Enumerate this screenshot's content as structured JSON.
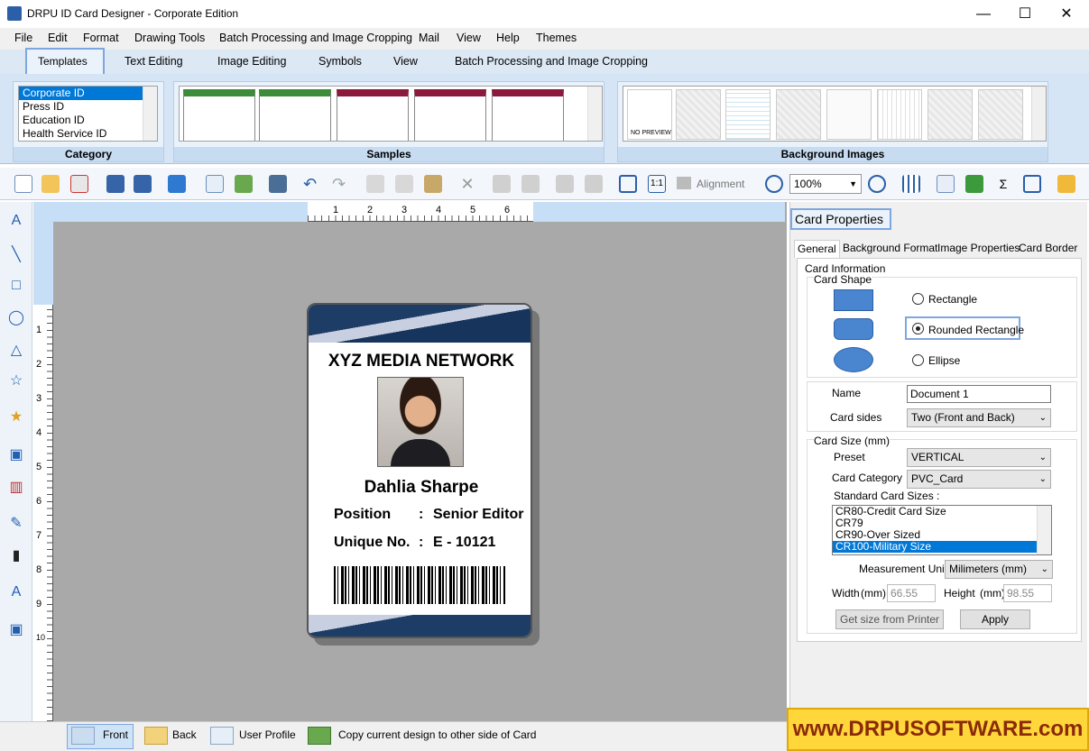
{
  "window": {
    "title": "DRPU ID Card Designer - Corporate Edition",
    "min": "—",
    "max": "☐",
    "close": "✕"
  },
  "menu": [
    "File",
    "Edit",
    "Format",
    "Drawing Tools",
    "Batch Processing and Image Cropping",
    "Mail",
    "View",
    "Help",
    "Themes"
  ],
  "ribbon_tabs": [
    "Templates",
    "Text Editing",
    "Image Editing",
    "Symbols",
    "View",
    "Batch Processing and Image Cropping"
  ],
  "category": {
    "label": "Category",
    "items": [
      "Corporate ID",
      "Press ID",
      "Education ID",
      "Health Service ID"
    ],
    "selected": "Corporate ID"
  },
  "samples": {
    "label": "Samples"
  },
  "backgrounds": {
    "label": "Background Images",
    "no_preview": "NO PREVIEW"
  },
  "toolbar": {
    "alignment": "Alignment",
    "zoom": "100%"
  },
  "ruler_top": [
    "1",
    "2",
    "3",
    "4",
    "5",
    "6"
  ],
  "ruler_left": [
    "1",
    "2",
    "3",
    "4",
    "5",
    "6",
    "7",
    "8",
    "9",
    "10"
  ],
  "card": {
    "org": "XYZ MEDIA NETWORK",
    "name": "Dahlia Sharpe",
    "position_label": "Position",
    "position_value": "Senior Editor",
    "unique_label": "Unique No.",
    "unique_value": "E - 10121",
    "colon": ":"
  },
  "panel": {
    "title": "Card Properties",
    "tabs": [
      "General",
      "Background Format",
      "Image Properties",
      "Card Border"
    ],
    "card_info": "Card Information",
    "card_shape": "Card Shape",
    "shapes": [
      "Rectangle",
      "Rounded Rectangle",
      "Ellipse"
    ],
    "selected_shape": "Rounded Rectangle",
    "name_label": "Name",
    "name_value": "Document 1",
    "sides_label": "Card sides",
    "sides_value": "Two (Front and Back)",
    "size_label": "Card Size (mm)",
    "preset_label": "Preset",
    "preset_value": "VERTICAL",
    "category_label": "Card Category",
    "category_value": "PVC_Card",
    "std_label": "Standard Card Sizes :",
    "std_sizes": [
      "CR80-Credit Card Size",
      "CR79",
      "CR90-Over Sized",
      "CR100-Military Size"
    ],
    "std_selected": "CR100-Military Size",
    "unit_label": "Measurement Unit :",
    "unit_value": "Milimeters (mm)",
    "width_label": "Width",
    "width_unit": "(mm)",
    "width_value": "66.55",
    "height_label": "Height",
    "height_unit": "(mm)",
    "height_value": "98.55",
    "printer_btn": "Get size from Printer",
    "apply_btn": "Apply"
  },
  "bottom": {
    "front": "Front",
    "back": "Back",
    "profile": "User Profile",
    "copy": "Copy current design to other side of Card"
  },
  "promo": "www.DRPUSOFTWARE.com"
}
